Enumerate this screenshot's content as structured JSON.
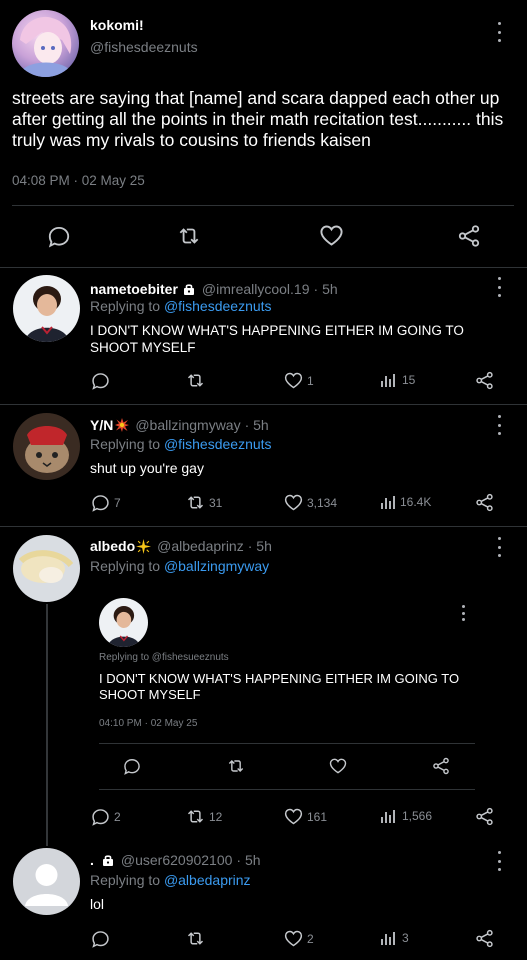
{
  "main_tweet": {
    "name": "kokomi!",
    "handle": "@fishesdeeznuts",
    "text": "streets are saying that [name] and scara dapped each other up after getting all the points in their math recitation test........... this truly was my rivals to cousins to friends kaisen",
    "timestamp": "04:08 PM · 02 May 25"
  },
  "replies": [
    {
      "name": "nametoebiter",
      "handle": "@imreallycool.19",
      "time": "· 5h",
      "replying_prefix": "Replying to ",
      "replying_to": "@fishesdeeznuts",
      "text": "I DON'T KNOW WHAT'S HAPPENING EITHER IM GOING TO SHOOT MYSELF",
      "replies_count": "",
      "retweets_count": "",
      "likes_count": "1",
      "views_count": "15"
    },
    {
      "name": "Y/N",
      "handle": "@ballzingmyway",
      "time": "· 5h",
      "replying_prefix": "Replying to ",
      "replying_to": "@fishesdeeznuts",
      "text": "shut up you're gay",
      "replies_count": "7",
      "retweets_count": "31",
      "likes_count": "3,134",
      "views_count": "16.4K"
    },
    {
      "name": "albedo",
      "handle": "@albedaprinz",
      "time": "· 5h",
      "replying_prefix": "Replying to ",
      "replying_to": "@ballzingmyway",
      "replies_count": "2",
      "retweets_count": "12",
      "likes_count": "161",
      "views_count": "1,566",
      "quoted": {
        "replying_to": "Replying to @fishesueeznuts",
        "text": "I DON'T KNOW WHAT'S HAPPENING EITHER IM GOING TO SHOOT MYSELF",
        "timestamp": "04:10 PM · 02 May 25"
      }
    },
    {
      "name": ".",
      "handle": "@user620902100",
      "time": "· 5h",
      "replying_prefix": "Replying to ",
      "replying_to": "@albedaprinz",
      "text": "lol",
      "replies_count": "",
      "retweets_count": "",
      "likes_count": "2",
      "views_count": "3"
    }
  ],
  "colors": {
    "background": "#000000",
    "link": "#3b9bf0",
    "muted": "#7b7f84",
    "star_yellow": "#f5c518",
    "badge_red": "#e0452b"
  }
}
